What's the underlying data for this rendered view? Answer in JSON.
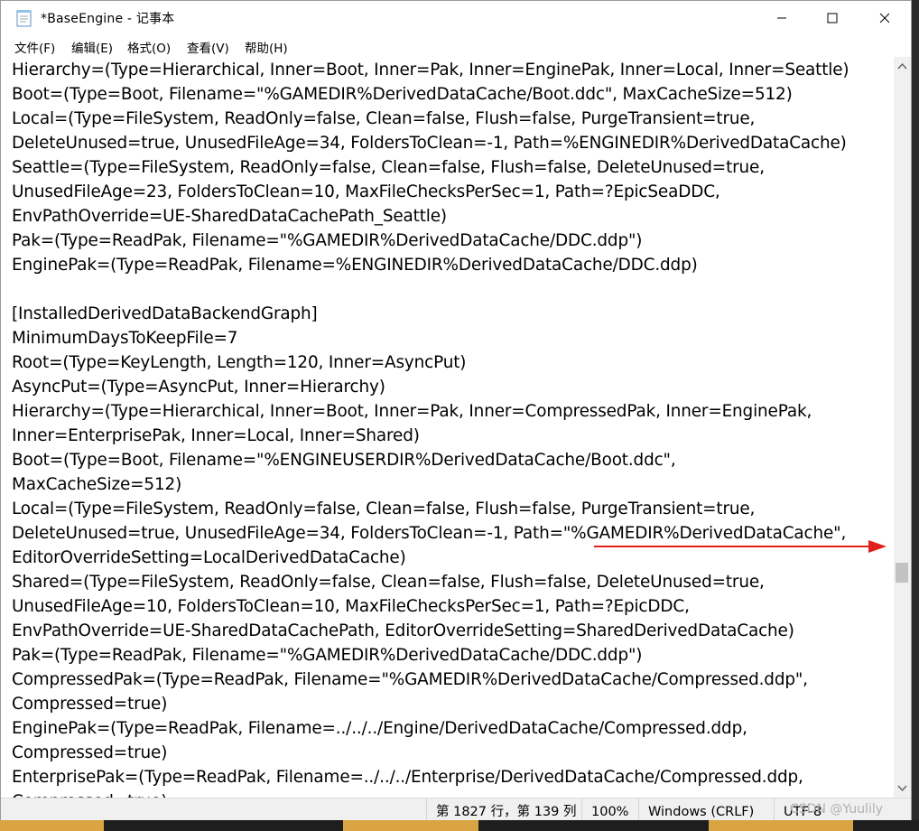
{
  "window": {
    "title": "*BaseEngine - 记事本"
  },
  "menu": [
    "文件(F)",
    "编辑(E)",
    "格式(O)",
    "查看(V)",
    "帮助(H)"
  ],
  "lines": [
    "Hierarchy=(Type=Hierarchical, Inner=Boot, Inner=Pak, Inner=EnginePak, Inner=Local, Inner=Seattle)",
    "Boot=(Type=Boot, Filename=\"%GAMEDIR%DerivedDataCache/Boot.ddc\", MaxCacheSize=512)",
    "Local=(Type=FileSystem, ReadOnly=false, Clean=false, Flush=false, PurgeTransient=true,",
    "DeleteUnused=true, UnusedFileAge=34, FoldersToClean=-1, Path=%ENGINEDIR%DerivedDataCache)",
    "Seattle=(Type=FileSystem, ReadOnly=false, Clean=false, Flush=false, DeleteUnused=true,",
    "UnusedFileAge=23, FoldersToClean=10, MaxFileChecksPerSec=1, Path=?EpicSeaDDC,",
    "EnvPathOverride=UE-SharedDataCachePath_Seattle)",
    "Pak=(Type=ReadPak, Filename=\"%GAMEDIR%DerivedDataCache/DDC.ddp\")",
    "EnginePak=(Type=ReadPak, Filename=%ENGINEDIR%DerivedDataCache/DDC.ddp)",
    "",
    "[InstalledDerivedDataBackendGraph]",
    "MinimumDaysToKeepFile=7",
    "Root=(Type=KeyLength, Length=120, Inner=AsyncPut)",
    "AsyncPut=(Type=AsyncPut, Inner=Hierarchy)",
    "Hierarchy=(Type=Hierarchical, Inner=Boot, Inner=Pak, Inner=CompressedPak, Inner=EnginePak,",
    "Inner=EnterprisePak, Inner=Local, Inner=Shared)",
    "Boot=(Type=Boot, Filename=\"%ENGINEUSERDIR%DerivedDataCache/Boot.ddc\",",
    "MaxCacheSize=512)",
    "Local=(Type=FileSystem, ReadOnly=false, Clean=false, Flush=false, PurgeTransient=true,",
    "DeleteUnused=true, UnusedFileAge=34, FoldersToClean=-1, Path=\"%GAMEDIR%DerivedDataCache\",",
    "EditorOverrideSetting=LocalDerivedDataCache)",
    "Shared=(Type=FileSystem, ReadOnly=false, Clean=false, Flush=false, DeleteUnused=true,",
    "UnusedFileAge=10, FoldersToClean=10, MaxFileChecksPerSec=1, Path=?EpicDDC,",
    "EnvPathOverride=UE-SharedDataCachePath, EditorOverrideSetting=SharedDerivedDataCache)",
    "Pak=(Type=ReadPak, Filename=\"%GAMEDIR%DerivedDataCache/DDC.ddp\")",
    "CompressedPak=(Type=ReadPak, Filename=\"%GAMEDIR%DerivedDataCache/Compressed.ddp\",",
    "Compressed=true)",
    "EnginePak=(Type=ReadPak, Filename=../../../Engine/DerivedDataCache/Compressed.ddp,",
    "Compressed=true)",
    "EnterprisePak=(Type=ReadPak, Filename=../../../Enterprise/DerivedDataCache/Compressed.ddp,",
    "Compressed=true)"
  ],
  "status": {
    "position": "第 1827 行，第 139 列",
    "zoom": "100%",
    "line_ending": "Windows (CRLF)",
    "encoding": "UTF-8"
  },
  "watermark": "CSDN @Yuulily",
  "colors": {
    "annotation": "#e0201b"
  }
}
